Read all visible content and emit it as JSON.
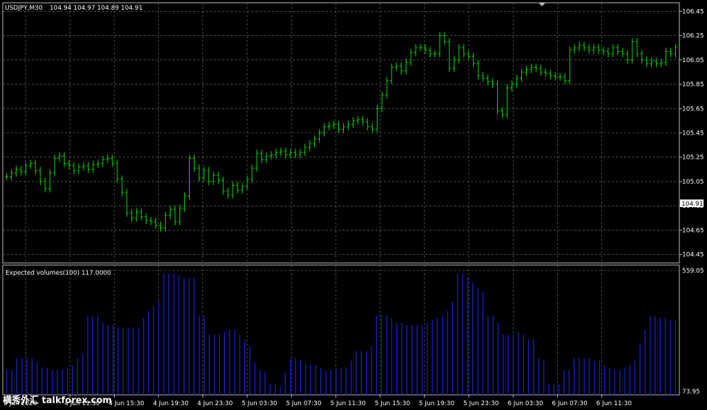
{
  "colors": {
    "background": "#000000",
    "grid": "#808080",
    "frame": "#c0c0c0",
    "bar_up": "#00e000",
    "volume": "#1c1ccc",
    "text": "#ffffff",
    "price_tag_bg": "#ffffff",
    "price_tag_text": "#000000"
  },
  "header": {
    "symbol": "USDJPY,M30",
    "ohlc": "104.94 104.97 104.89 104.91"
  },
  "watermark": "横秀外汇 talkforex.com",
  "chart_data": [
    {
      "type": "ohlc",
      "title": "USDJPY,M30",
      "ylim": [
        104.38,
        106.52
      ],
      "y_ticks": [
        "106.45",
        "106.25",
        "106.05",
        "105.85",
        "105.65",
        "105.45",
        "105.25",
        "105.05",
        "104.85",
        "104.65",
        "104.45"
      ],
      "current_price": "104.91",
      "grid": true,
      "values_close": [
        105.09,
        105.12,
        105.15,
        105.13,
        105.18,
        105.2,
        105.14,
        105.05,
        104.99,
        105.12,
        105.24,
        105.26,
        105.2,
        105.18,
        105.14,
        105.17,
        105.18,
        105.15,
        105.19,
        105.2,
        105.23,
        105.24,
        105.2,
        105.07,
        104.96,
        104.79,
        104.75,
        104.8,
        104.76,
        104.73,
        104.72,
        104.69,
        104.67,
        104.77,
        104.82,
        104.72,
        104.83,
        104.93,
        105.24,
        105.16,
        105.08,
        105.14,
        105.05,
        105.1,
        105.06,
        104.97,
        104.94,
        105.02,
        104.98,
        105.01,
        105.07,
        105.16,
        105.28,
        105.23,
        105.26,
        105.27,
        105.29,
        105.3,
        105.27,
        105.29,
        105.27,
        105.29,
        105.33,
        105.36,
        105.4,
        105.45,
        105.5,
        105.51,
        105.52,
        105.48,
        105.5,
        105.52,
        105.55,
        105.56,
        105.54,
        105.5,
        105.48,
        105.65,
        105.76,
        105.88,
        105.99,
        106.0,
        105.96,
        106.03,
        106.11,
        106.15,
        106.15,
        106.13,
        106.1,
        106.1,
        106.25,
        106.2,
        105.98,
        106.05,
        106.15,
        106.1,
        106.08,
        106.02,
        105.92,
        105.9,
        105.87,
        105.85,
        105.63,
        105.6,
        105.82,
        105.85,
        105.9,
        105.95,
        105.97,
        105.99,
        105.98,
        105.95,
        105.94,
        105.92,
        105.91,
        105.91,
        105.88,
        106.13,
        106.15,
        106.17,
        106.15,
        106.13,
        106.15,
        106.13,
        106.12,
        106.1,
        106.15,
        106.12,
        106.1,
        106.05,
        106.2,
        106.1,
        106.05,
        106.02,
        106.04,
        106.02,
        106.03,
        106.12,
        106.1,
        106.15
      ],
      "tick_span": 0.1
    },
    {
      "type": "bar",
      "title": "Expected volumes(100) 117.0000",
      "ylim": [
        73.95,
        559.05
      ],
      "y_ticks": [
        "559.05",
        "73.95"
      ],
      "values": [
        150,
        150,
        200,
        200,
        200,
        200,
        180,
        160,
        160,
        150,
        150,
        150,
        160,
        170,
        200,
        220,
        380,
        380,
        380,
        350,
        340,
        340,
        330,
        330,
        330,
        330,
        330,
        370,
        400,
        420,
        450,
        559,
        559,
        559,
        550,
        540,
        540,
        540,
        380,
        380,
        300,
        300,
        300,
        310,
        320,
        320,
        300,
        280,
        250,
        180,
        150,
        140,
        90,
        90,
        80,
        140,
        200,
        200,
        190,
        180,
        170,
        170,
        160,
        150,
        150,
        150,
        160,
        160,
        190,
        230,
        230,
        230,
        250,
        380,
        380,
        380,
        370,
        350,
        350,
        340,
        340,
        340,
        340,
        350,
        360,
        370,
        380,
        400,
        440,
        559,
        559,
        540,
        520,
        500,
        480,
        380,
        380,
        350,
        300,
        300,
        300,
        310,
        300,
        280,
        280,
        200,
        190,
        90,
        90,
        90,
        150,
        150,
        200,
        200,
        200,
        200,
        190,
        190,
        170,
        160,
        150,
        150,
        160,
        170,
        190,
        260,
        320,
        380,
        380,
        370,
        370,
        360,
        360
      ]
    }
  ],
  "x_ticks": [
    "3 Jun 2020",
    "4 Jun 11:30",
    "4 Jun 15:30",
    "4 Jun 19:30",
    "4 Jun 23:30",
    "5 Jun 03:30",
    "5 Jun 07:30",
    "5 Jun 11:30",
    "5 Jun 15:30",
    "5 Jun 19:30",
    "5 Jun 23:30",
    "6 Jun 03:30",
    "6 Jun 07:30",
    "6 Jun 11:30"
  ]
}
